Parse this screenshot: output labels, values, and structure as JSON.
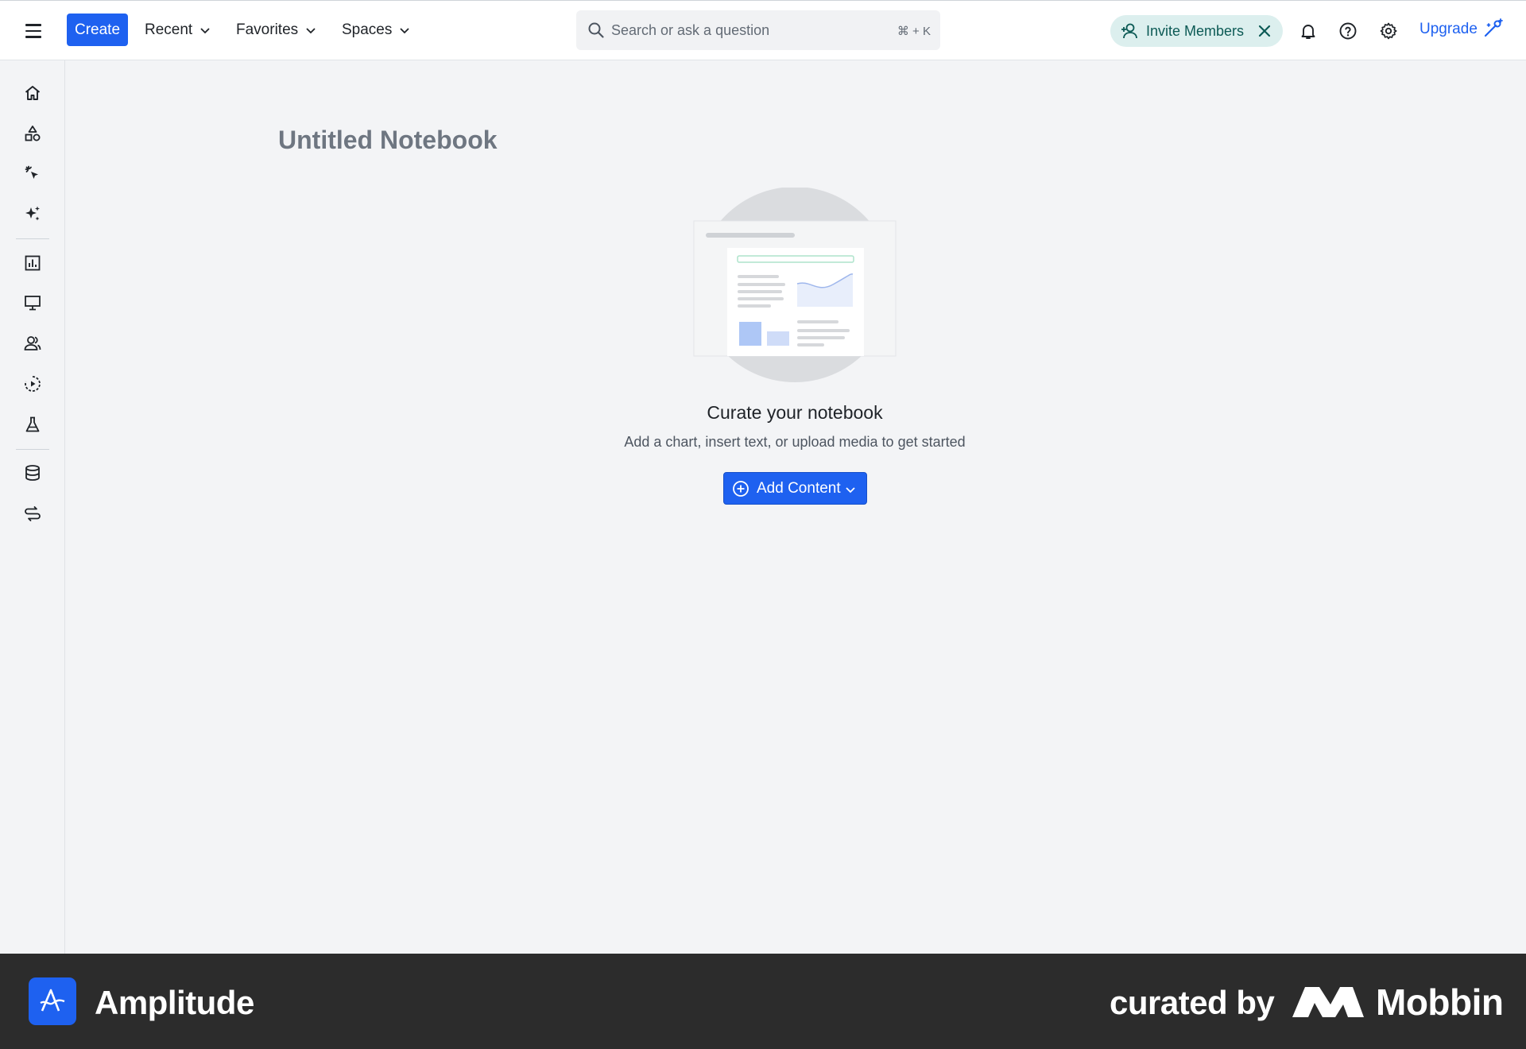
{
  "topbar": {
    "menu_icon": "hamburger-menu-icon",
    "create_label": "Create",
    "nav": [
      {
        "label": "Recent"
      },
      {
        "label": "Favorites"
      },
      {
        "label": "Spaces"
      }
    ],
    "search": {
      "placeholder": "Search or ask a question",
      "shortcut": "⌘ + K"
    },
    "invite_label": "Invite Members",
    "upgrade_label": "Upgrade",
    "colors": {
      "primary": "#1e61f0",
      "invite_bg": "#dcefee",
      "invite_text": "#0c5a55"
    }
  },
  "sidebar": {
    "icons": [
      "home-icon",
      "shapes-icon",
      "cursor-click-icon",
      "sparkles-icon",
      "bar-chart-icon",
      "monitor-icon",
      "users-icon",
      "session-replay-icon",
      "beaker-icon",
      "database-icon",
      "data-flow-icon"
    ]
  },
  "main": {
    "title": "Untitled Notebook",
    "empty_heading": "Curate your notebook",
    "empty_sub": "Add a chart, insert text, or upload media to get started",
    "add_content_label": "Add Content"
  },
  "footer": {
    "brand": "Amplitude",
    "curated_by": "curated by",
    "mobbin": "Mobbin"
  }
}
